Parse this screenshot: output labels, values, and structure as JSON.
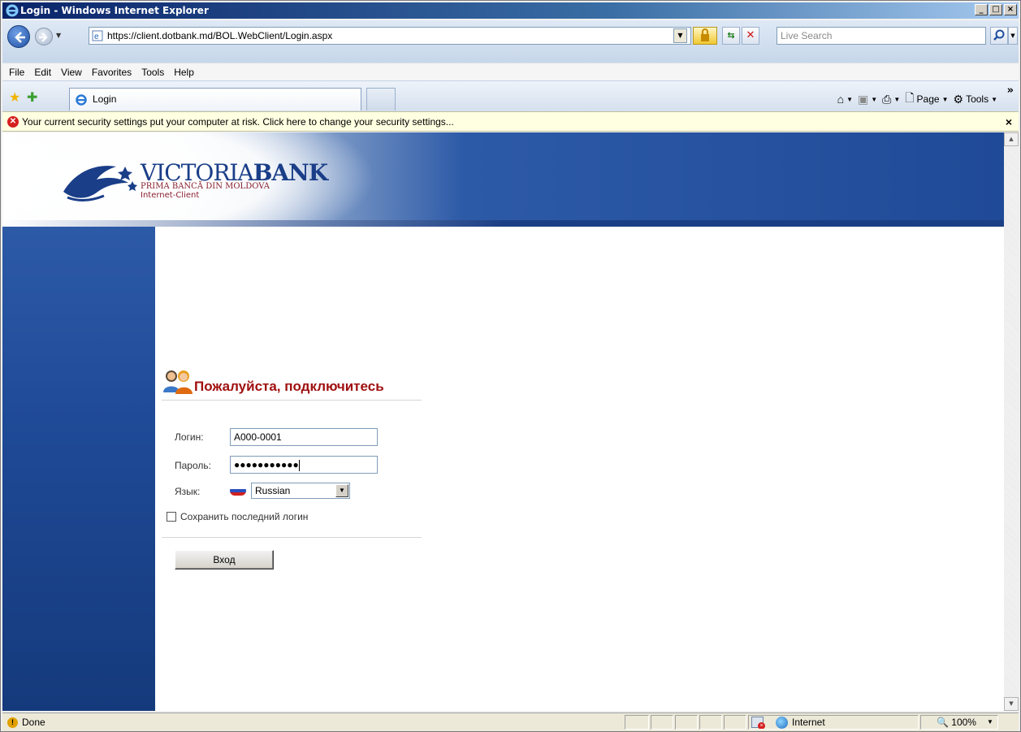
{
  "window": {
    "title": "Login - Windows Internet Explorer",
    "min_label": "_",
    "max_label": "□",
    "close_label": "×"
  },
  "address": {
    "url": "https://client.dotbank.md/BOL.WebClient/Login.aspx",
    "search_placeholder": "Live Search"
  },
  "menu": {
    "items": [
      "File",
      "Edit",
      "View",
      "Favorites",
      "Tools",
      "Help"
    ]
  },
  "tabs": {
    "active_label": "Login"
  },
  "command_bar": {
    "page_label": "Page",
    "tools_label": "Tools"
  },
  "infobar": {
    "text": "Your current security settings put your computer at risk. Click here to change your security settings...",
    "close_label": "×"
  },
  "bank": {
    "logo_part1": "VICTORIA",
    "logo_part2": "BANK",
    "tagline": "PRIMA BANCĂ DIN MOLDOVA",
    "product": "Internet-Client"
  },
  "login": {
    "heading": "Пожалуйста, подключитесь",
    "login_label": "Логин:",
    "login_value": "A000-0001",
    "password_label": "Пароль:",
    "password_mask": "●●●●●●●●●●●",
    "language_label": "Язык:",
    "language_value": "Russian",
    "remember_label": "Сохранить последний логин",
    "submit_label": "Вход"
  },
  "status": {
    "text": "Done",
    "zone": "Internet",
    "zoom": "100%"
  },
  "colors": {
    "heading_red": "#a01010",
    "bank_blue": "#1f4a97",
    "infobar_bg": "#ffffe1"
  }
}
